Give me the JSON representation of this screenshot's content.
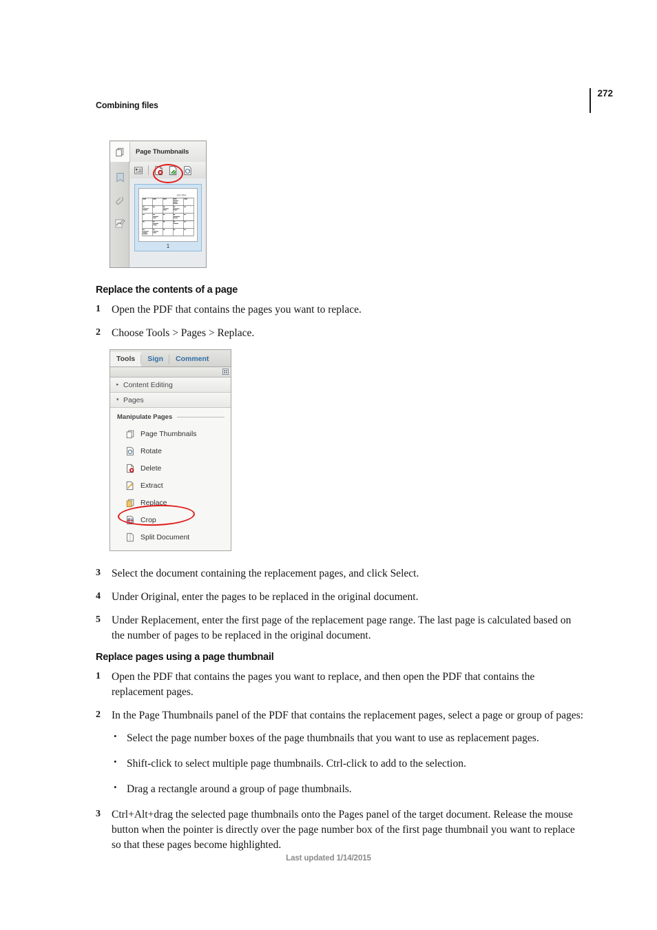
{
  "header": {
    "title": "Combining files",
    "page_number": "272"
  },
  "figure_thumbnails_panel": {
    "panel_title": "Page Thumbnails",
    "rail_icons": [
      "bookmarks-icon",
      "attachments-icon",
      "signatures-icon"
    ],
    "toolbar_icons": [
      "options-menu-icon",
      "delete-pages-icon",
      "extract-pages-icon",
      "rotate-pages-icon"
    ],
    "thumbnail_caption": "1",
    "highlight_target": "delete-pages-icon"
  },
  "section_replace_contents": {
    "heading": "Replace the contents of a page",
    "steps": [
      {
        "num": "1",
        "text": "Open the PDF that contains the pages you want to replace."
      },
      {
        "num": "2",
        "text": "Choose Tools > Pages > Replace."
      }
    ],
    "steps_after": [
      {
        "num": "3",
        "text": "Select the document containing the replacement pages, and click Select."
      },
      {
        "num": "4",
        "text": "Under Original, enter the pages to be replaced in the original document."
      },
      {
        "num": "5",
        "text": "Under Replacement, enter the first page of the replacement page range. The last page is calculated based on the number of pages to be replaced in the original document."
      }
    ]
  },
  "figure_tools_panel": {
    "tabs": [
      {
        "label": "Tools",
        "active": true
      },
      {
        "label": "Sign",
        "active": false
      },
      {
        "label": "Comment",
        "active": false
      }
    ],
    "accordion": [
      {
        "label": "Content Editing",
        "expanded": false,
        "triangle": "▸"
      },
      {
        "label": "Pages",
        "expanded": true,
        "triangle": "▾"
      }
    ],
    "group_label": "Manipulate Pages",
    "menu_items": [
      {
        "label": "Page Thumbnails",
        "icon": "page-thumbnails-icon"
      },
      {
        "label": "Rotate",
        "icon": "rotate-icon"
      },
      {
        "label": "Delete",
        "icon": "delete-icon"
      },
      {
        "label": "Extract",
        "icon": "extract-icon"
      },
      {
        "label": "Replace",
        "icon": "replace-icon"
      },
      {
        "label": "Crop",
        "icon": "crop-icon"
      },
      {
        "label": "Split Document",
        "icon": "split-document-icon"
      }
    ],
    "highlight_target": "Replace",
    "grid_icon": "panel-options-icon"
  },
  "section_replace_thumbnail": {
    "heading": "Replace pages using a page thumbnail",
    "step1": {
      "num": "1",
      "text": "Open the PDF that contains the pages you want to replace, and then open the PDF that contains the replacement pages."
    },
    "step2": {
      "num": "2",
      "text": "In the Page Thumbnails panel of the PDF that contains the replacement pages, select a page or group of pages:"
    },
    "bullets": [
      "Select the page number boxes of the page thumbnails that you want to use as replacement pages.",
      "Shift-click to select multiple page thumbnails. Ctrl-click to add to the selection.",
      "Drag a rectangle around a group of page thumbnails."
    ],
    "step3": {
      "num": "3",
      "text": "Ctrl+Alt+drag the selected page thumbnails onto the Pages panel of the target document. Release the mouse button when the pointer is directly over the page number box of the first page thumbnail you want to replace so that these pages become highlighted."
    }
  },
  "footer": {
    "text": "Last updated 1/14/2015"
  },
  "colors": {
    "highlight_ellipse": "#e01b1b",
    "link_blue": "#2f6ea5",
    "footer_gray": "#8a8a8a",
    "selection_blue": "#cfe3f3"
  }
}
